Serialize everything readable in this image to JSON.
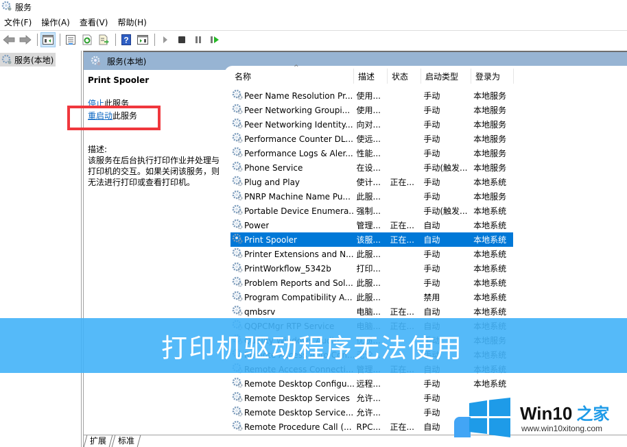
{
  "window": {
    "title": "服务",
    "icon": "gear-icon"
  },
  "menu": [
    {
      "label": "文件(F)"
    },
    {
      "label": "操作(A)"
    },
    {
      "label": "查看(V)"
    },
    {
      "label": "帮助(H)"
    }
  ],
  "toolbar": {
    "buttons": [
      "back-icon",
      "forward-icon",
      "show-hide-console-tree-icon",
      "properties-icon",
      "refresh-icon",
      "export-list-icon",
      "help-icon",
      "show-action-pane-icon",
      "start-service-icon",
      "stop-service-icon",
      "pause-service-icon",
      "resume-service-icon"
    ]
  },
  "tree": {
    "item": "服务(本地)"
  },
  "pane": {
    "header": "服务(本地)"
  },
  "detail": {
    "service_name": "Print Spooler",
    "stop_link": "停止",
    "stop_rest": "此服务",
    "restart_link": "重启动",
    "restart_rest": "此服务",
    "desc_label": "描述:",
    "desc_text": "该服务在后台执行打印作业并处理与打印机的交互。如果关闭该服务，则无法进行打印或查看打印机。"
  },
  "columns": {
    "name": "名称",
    "desc": "描述",
    "status": "状态",
    "start": "启动类型",
    "logon": "登录为"
  },
  "services": [
    {
      "name": "Peer Name Resolution Pr...",
      "desc": "使用...",
      "status": "",
      "start": "手动",
      "logon": "本地服务"
    },
    {
      "name": "Peer Networking Groupi...",
      "desc": "使用...",
      "status": "",
      "start": "手动",
      "logon": "本地服务"
    },
    {
      "name": "Peer Networking Identity...",
      "desc": "向对...",
      "status": "",
      "start": "手动",
      "logon": "本地服务"
    },
    {
      "name": "Performance Counter DL...",
      "desc": "使远...",
      "status": "",
      "start": "手动",
      "logon": "本地服务"
    },
    {
      "name": "Performance Logs & Aler...",
      "desc": "性能...",
      "status": "",
      "start": "手动",
      "logon": "本地服务"
    },
    {
      "name": "Phone Service",
      "desc": "在设...",
      "status": "",
      "start": "手动(触发...",
      "logon": "本地服务"
    },
    {
      "name": "Plug and Play",
      "desc": "使计...",
      "status": "正在...",
      "start": "手动",
      "logon": "本地系统"
    },
    {
      "name": "PNRP Machine Name Pu...",
      "desc": "此服...",
      "status": "",
      "start": "手动",
      "logon": "本地服务"
    },
    {
      "name": "Portable Device Enumera...",
      "desc": "强制...",
      "status": "",
      "start": "手动(触发...",
      "logon": "本地系统"
    },
    {
      "name": "Power",
      "desc": "管理...",
      "status": "正在...",
      "start": "自动",
      "logon": "本地系统"
    },
    {
      "name": "Print Spooler",
      "desc": "该服...",
      "status": "正在...",
      "start": "自动",
      "logon": "本地系统",
      "selected": true
    },
    {
      "name": "Printer Extensions and N...",
      "desc": "此服...",
      "status": "",
      "start": "手动",
      "logon": "本地系统"
    },
    {
      "name": "PrintWorkflow_5342b",
      "desc": "打印...",
      "status": "",
      "start": "手动",
      "logon": "本地系统"
    },
    {
      "name": "Problem Reports and Sol...",
      "desc": "此服...",
      "status": "",
      "start": "手动",
      "logon": "本地系统"
    },
    {
      "name": "Program Compatibility A...",
      "desc": "此服...",
      "status": "",
      "start": "禁用",
      "logon": "本地系统"
    },
    {
      "name": "qmbsrv",
      "desc": "电脑...",
      "status": "正在...",
      "start": "自动",
      "logon": "本地系统"
    },
    {
      "name": "QQPCMgr RTP Service",
      "desc": "电脑...",
      "status": "正在...",
      "start": "自动",
      "logon": "本地系统"
    },
    {
      "name": "Quality Windows Audio...",
      "desc": "优质...",
      "status": "",
      "start": "手动",
      "logon": "本地服务"
    },
    {
      "name": "Remote Access Auto Con...",
      "desc": "无论...",
      "status": "",
      "start": "手动",
      "logon": "本地系统"
    },
    {
      "name": "Remote Access Connecti...",
      "desc": "管理...",
      "status": "正在...",
      "start": "自动",
      "logon": "本地系统"
    },
    {
      "name": "Remote Desktop Configu...",
      "desc": "远程...",
      "status": "",
      "start": "手动",
      "logon": "本地系统"
    },
    {
      "name": "Remote Desktop Services",
      "desc": "允许...",
      "status": "",
      "start": "手动",
      "logon": ""
    },
    {
      "name": "Remote Desktop Service...",
      "desc": "允许...",
      "status": "",
      "start": "手动",
      "logon": ""
    },
    {
      "name": "Remote Procedure Call (...",
      "desc": "RPC...",
      "status": "正在...",
      "start": "自动",
      "logon": ""
    }
  ],
  "bottom_tabs": [
    {
      "label": "扩展"
    },
    {
      "label": "标准"
    }
  ],
  "banner": {
    "text": "打印机驱动程序无法使用"
  },
  "watermark": {
    "brand": "Win10",
    "brand_cn": "之家",
    "url": "www.win10xitong.com"
  },
  "colors": {
    "selection": "#0078d7",
    "pane_header": "#97b4d3",
    "banner": "#42b3f8",
    "highlight_box": "#f0373d",
    "link": "#0a66c2"
  }
}
